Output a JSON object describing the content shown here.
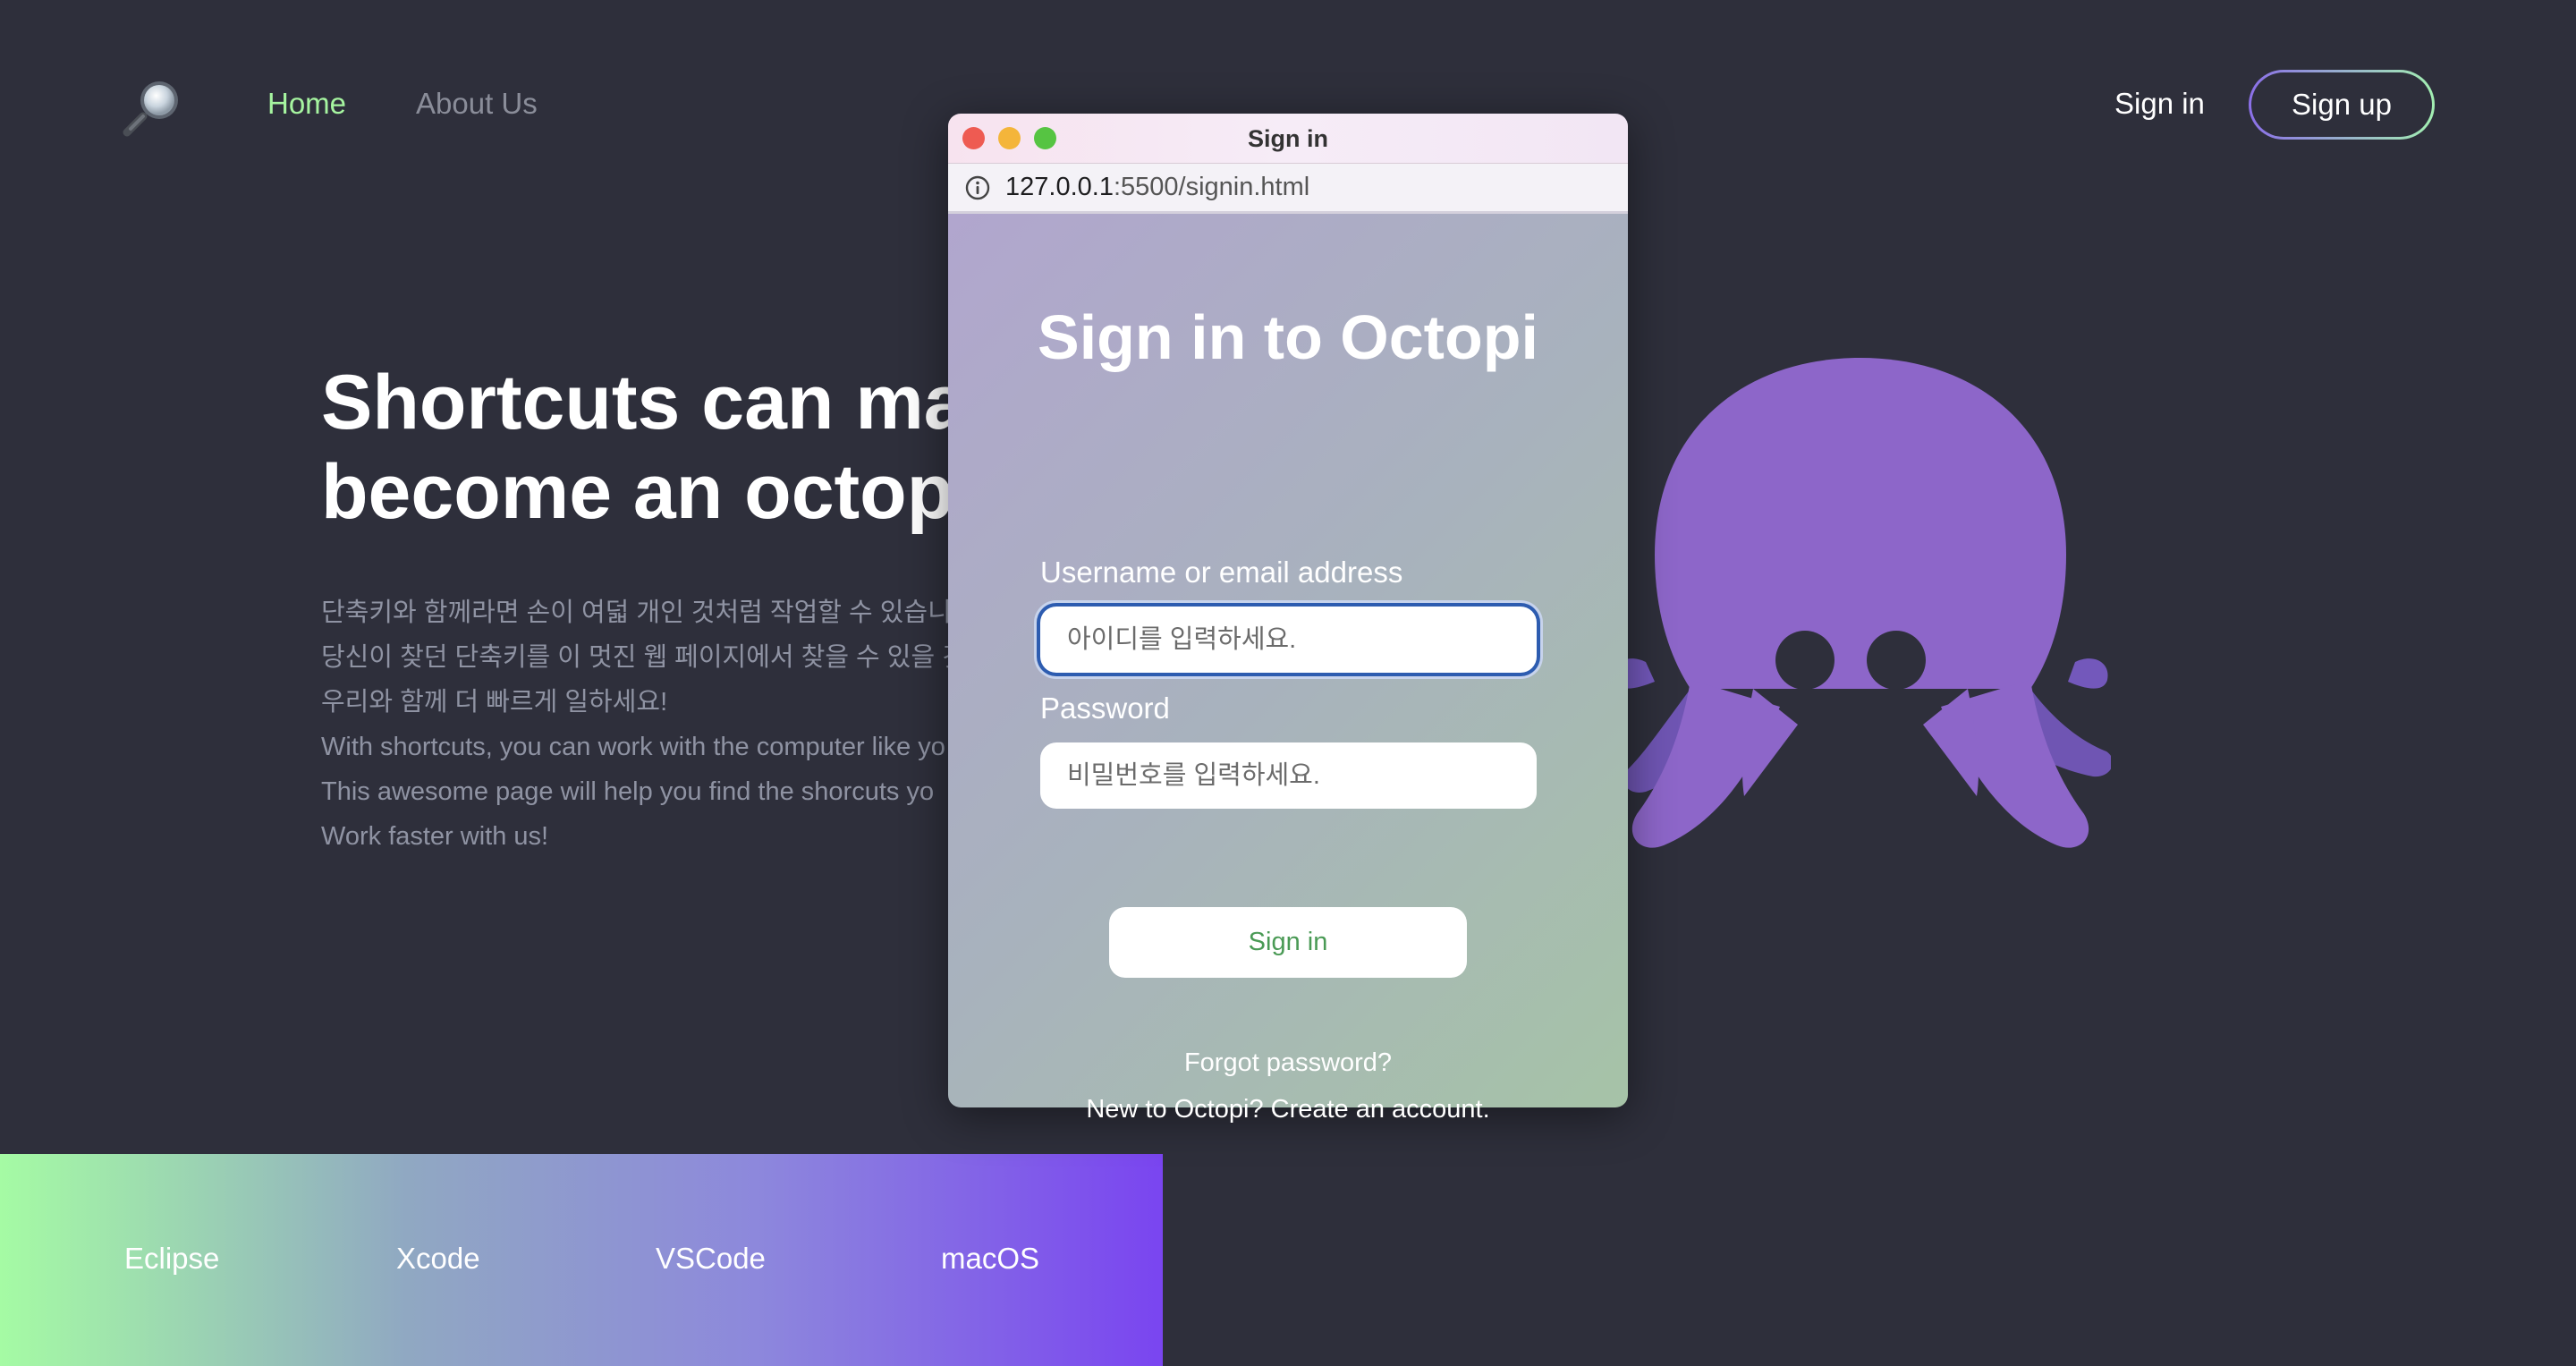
{
  "header": {
    "nav": [
      {
        "label": "Home",
        "active": true
      },
      {
        "label": "About Us",
        "active": false
      }
    ],
    "signin_label": "Sign in",
    "signup_label": "Sign up",
    "active_color": "#a6f5a0"
  },
  "hero": {
    "title_line1": "Shortcuts can ma",
    "title_line2": "become an octop",
    "desc": [
      "단축키와 함께라면 손이 여덟 개인 것처럼 작업할 수 있습니다",
      "당신이 찾던 단축키를 이 멋진 웹 페이지에서 찾을 수 있을 것",
      "우리와 함께 더 빠르게 일하세요!",
      "With shortcuts, you can work with the computer like yo",
      "This awesome page will help you find the shorcuts yo",
      "Work faster with us!"
    ]
  },
  "bottom_bar": {
    "items": [
      "Eclipse",
      "Xcode",
      "VSCode",
      "macOS"
    ]
  },
  "window": {
    "title": "Sign in",
    "url_host": "127.0.0.1",
    "url_path": ":5500/signin.html",
    "form": {
      "heading": "Sign in to Octopi",
      "username_label": "Username or email address",
      "username_placeholder": "아이디를 입력하세요.",
      "username_value": "",
      "password_label": "Password",
      "password_placeholder": "비밀번호를 입력하세요.",
      "password_value": "",
      "submit_label": "Sign in",
      "forgot_label": "Forgot password?",
      "new_account_label": "New to Octopi? Create an account."
    }
  },
  "icons": {
    "logo": "magnifying-glass-icon",
    "info": "info-circle-icon"
  }
}
